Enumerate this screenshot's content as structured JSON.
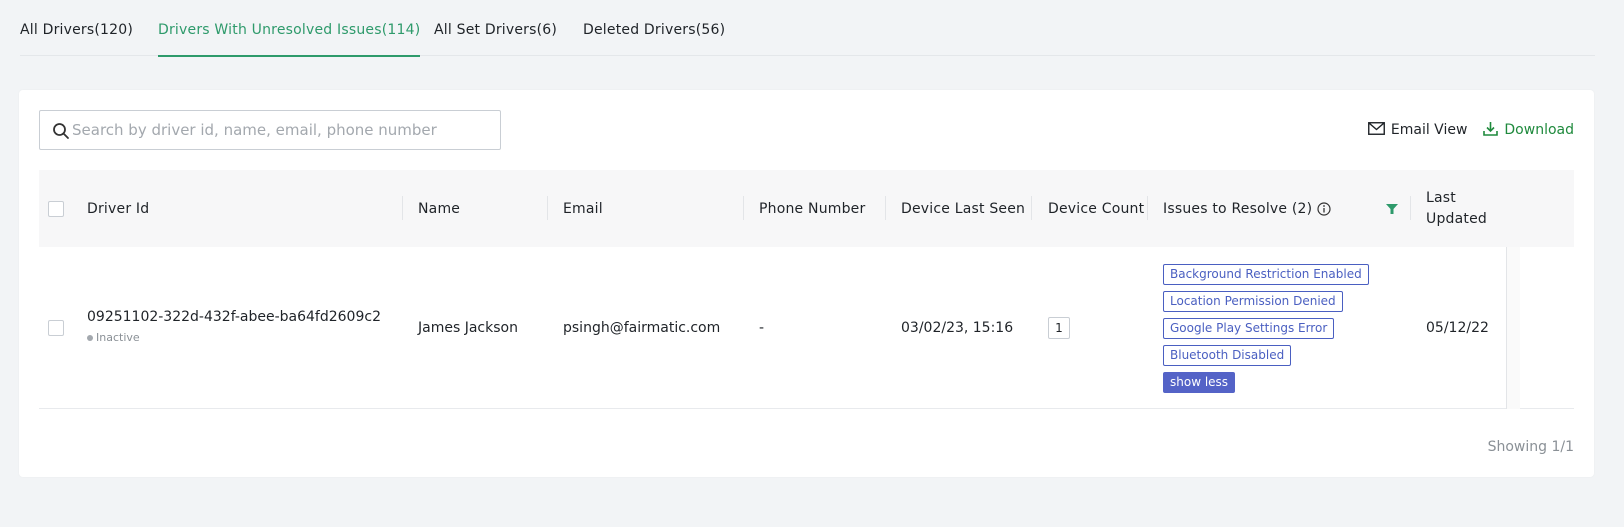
{
  "tabs": [
    {
      "label": "All Drivers(120)"
    },
    {
      "label": "Drivers With Unresolved Issues(114)"
    },
    {
      "label": "All Set Drivers(6)"
    },
    {
      "label": "Deleted Drivers(56)"
    }
  ],
  "search": {
    "placeholder": "Search by driver id, name, email, phone number",
    "value": ""
  },
  "actions": {
    "email_view": "Email View",
    "download": "Download"
  },
  "table": {
    "headers": {
      "driver_id": "Driver Id",
      "name": "Name",
      "email": "Email",
      "phone": "Phone Number",
      "device_last_seen": "Device Last Seen",
      "device_count": "Device Count",
      "issues": "Issues to Resolve (2)",
      "last_updated_1": "Last",
      "last_updated_2": "Updated"
    },
    "rows": [
      {
        "driver_id": "09251102-322d-432f-abee-ba64fd2609c2",
        "status": "Inactive",
        "name": "James Jackson",
        "email": "psingh@fairmatic.com",
        "phone": "-",
        "device_last_seen": "03/02/23, 15:16",
        "device_count": "1",
        "issues": [
          "Background Restriction Enabled",
          "Location Permission Denied",
          "Google Play Settings Error",
          "Bluetooth Disabled"
        ],
        "show_less": "show less",
        "last_updated": "05/12/22"
      }
    ]
  },
  "footer": {
    "showing": "Showing 1/1"
  },
  "colors": {
    "accent_green": "#2e9a6b",
    "download_green": "#1f8a3d",
    "issue_blue": "#4a5fc1"
  }
}
